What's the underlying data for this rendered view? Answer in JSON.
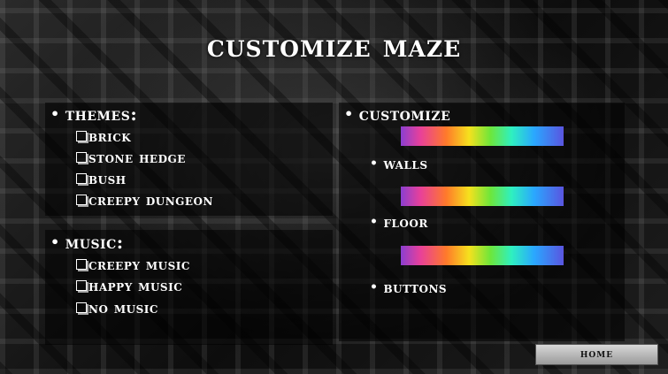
{
  "title": "Customize Maze",
  "themes": {
    "heading": "Themes:",
    "options": [
      "Brick",
      "Stone Hedge",
      "Bush",
      "Creepy Dungeon"
    ]
  },
  "music": {
    "heading": "Music:",
    "options": [
      "Creepy Music",
      "Happy Music",
      "No Music"
    ]
  },
  "customize": {
    "heading": "Customize",
    "walls_label": "Walls",
    "floor_label": "Floor",
    "buttons_label": "Buttons"
  },
  "home_label": "Home",
  "colors": {
    "rainbow_start": "#8a3fd1",
    "rainbow_mid": "#f5e11e",
    "rainbow_end": "#5a55e0"
  }
}
